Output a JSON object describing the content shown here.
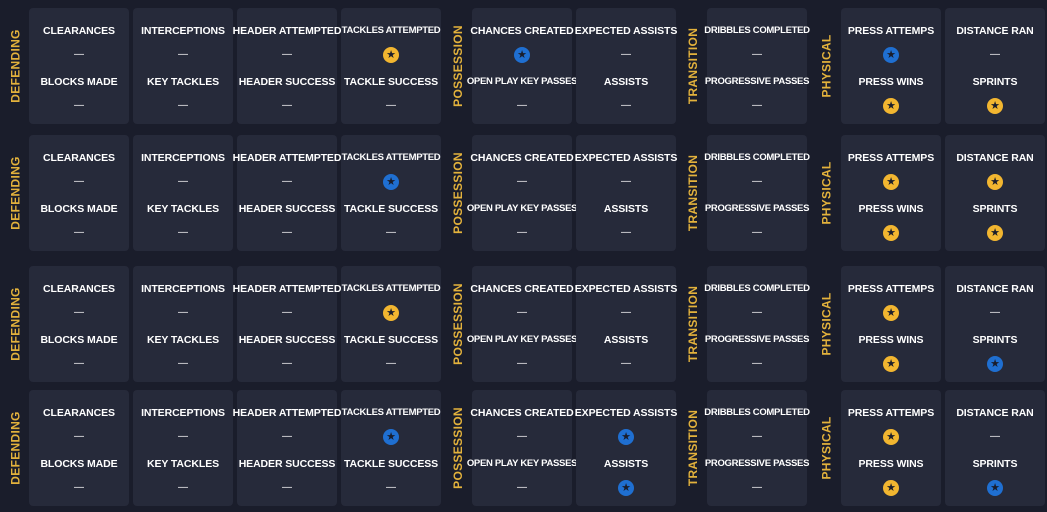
{
  "sections": {
    "defending": "DEFENDING",
    "possession": "POSSESSION",
    "transition": "TRANSITION",
    "physical": "PHYSICAL"
  },
  "colors": {
    "gold_star": "#f2b630",
    "blue_star": "#1f6fd1",
    "section_label": "#e3b23c"
  },
  "icons": {
    "star": "star-icon"
  },
  "dash": "—",
  "rows": [
    {
      "defending": [
        [
          {
            "label": "CLEARANCES",
            "value": "dash"
          },
          {
            "label": "BLOCKS MADE",
            "value": "dash"
          }
        ],
        [
          {
            "label": "INTERCEPTIONS",
            "value": "dash"
          },
          {
            "label": "KEY TACKLES",
            "value": "dash"
          }
        ],
        [
          {
            "label": "HEADER ATTEMPTED",
            "value": "dash"
          },
          {
            "label": "HEADER SUCCESS",
            "value": "dash"
          }
        ],
        [
          {
            "label": "TACKLES ATTEMPTED",
            "value": "gold"
          },
          {
            "label": "TACKLE SUCCESS",
            "value": "dash"
          }
        ]
      ],
      "possession": [
        [
          {
            "label": "CHANCES CREATED",
            "value": "blue"
          },
          {
            "label": "OPEN PLAY KEY PASSES",
            "value": "dash"
          }
        ],
        [
          {
            "label": "EXPECTED ASSISTS",
            "value": "dash"
          },
          {
            "label": "ASSISTS",
            "value": "dash"
          }
        ]
      ],
      "transition": [
        [
          {
            "label": "DRIBBLES COMPLETED",
            "value": "dash"
          },
          {
            "label": "PROGRESSIVE PASSES",
            "value": "dash"
          }
        ]
      ],
      "physical": [
        [
          {
            "label": "PRESS ATTEMPS",
            "value": "blue"
          },
          {
            "label": "PRESS WINS",
            "value": "gold"
          }
        ],
        [
          {
            "label": "DISTANCE RAN",
            "value": "dash"
          },
          {
            "label": "SPRINTS",
            "value": "gold"
          }
        ]
      ]
    },
    {
      "defending": [
        [
          {
            "label": "CLEARANCES",
            "value": "dash"
          },
          {
            "label": "BLOCKS MADE",
            "value": "dash"
          }
        ],
        [
          {
            "label": "INTERCEPTIONS",
            "value": "dash"
          },
          {
            "label": "KEY TACKLES",
            "value": "dash"
          }
        ],
        [
          {
            "label": "HEADER ATTEMPTED",
            "value": "dash"
          },
          {
            "label": "HEADER SUCCESS",
            "value": "dash"
          }
        ],
        [
          {
            "label": "TACKLES ATTEMPTED",
            "value": "blue"
          },
          {
            "label": "TACKLE SUCCESS",
            "value": "dash"
          }
        ]
      ],
      "possession": [
        [
          {
            "label": "CHANCES CREATED",
            "value": "dash"
          },
          {
            "label": "OPEN PLAY KEY PASSES",
            "value": "dash"
          }
        ],
        [
          {
            "label": "EXPECTED ASSISTS",
            "value": "dash"
          },
          {
            "label": "ASSISTS",
            "value": "dash"
          }
        ]
      ],
      "transition": [
        [
          {
            "label": "DRIBBLES COMPLETED",
            "value": "dash"
          },
          {
            "label": "PROGRESSIVE PASSES",
            "value": "dash"
          }
        ]
      ],
      "physical": [
        [
          {
            "label": "PRESS ATTEMPS",
            "value": "gold"
          },
          {
            "label": "PRESS WINS",
            "value": "gold"
          }
        ],
        [
          {
            "label": "DISTANCE RAN",
            "value": "gold"
          },
          {
            "label": "SPRINTS",
            "value": "gold"
          }
        ]
      ]
    },
    {
      "defending": [
        [
          {
            "label": "CLEARANCES",
            "value": "dash"
          },
          {
            "label": "BLOCKS MADE",
            "value": "dash"
          }
        ],
        [
          {
            "label": "INTERCEPTIONS",
            "value": "dash"
          },
          {
            "label": "KEY TACKLES",
            "value": "dash"
          }
        ],
        [
          {
            "label": "HEADER ATTEMPTED",
            "value": "dash"
          },
          {
            "label": "HEADER SUCCESS",
            "value": "dash"
          }
        ],
        [
          {
            "label": "TACKLES ATTEMPTED",
            "value": "gold"
          },
          {
            "label": "TACKLE SUCCESS",
            "value": "dash"
          }
        ]
      ],
      "possession": [
        [
          {
            "label": "CHANCES CREATED",
            "value": "dash"
          },
          {
            "label": "OPEN PLAY KEY PASSES",
            "value": "dash"
          }
        ],
        [
          {
            "label": "EXPECTED ASSISTS",
            "value": "dash"
          },
          {
            "label": "ASSISTS",
            "value": "dash"
          }
        ]
      ],
      "transition": [
        [
          {
            "label": "DRIBBLES COMPLETED",
            "value": "dash"
          },
          {
            "label": "PROGRESSIVE PASSES",
            "value": "dash"
          }
        ]
      ],
      "physical": [
        [
          {
            "label": "PRESS ATTEMPS",
            "value": "gold"
          },
          {
            "label": "PRESS WINS",
            "value": "gold"
          }
        ],
        [
          {
            "label": "DISTANCE RAN",
            "value": "dash"
          },
          {
            "label": "SPRINTS",
            "value": "blue"
          }
        ]
      ]
    },
    {
      "defending": [
        [
          {
            "label": "CLEARANCES",
            "value": "dash"
          },
          {
            "label": "BLOCKS MADE",
            "value": "dash"
          }
        ],
        [
          {
            "label": "INTERCEPTIONS",
            "value": "dash"
          },
          {
            "label": "KEY TACKLES",
            "value": "dash"
          }
        ],
        [
          {
            "label": "HEADER ATTEMPTED",
            "value": "dash"
          },
          {
            "label": "HEADER SUCCESS",
            "value": "dash"
          }
        ],
        [
          {
            "label": "TACKLES ATTEMPTED",
            "value": "blue"
          },
          {
            "label": "TACKLE SUCCESS",
            "value": "dash"
          }
        ]
      ],
      "possession": [
        [
          {
            "label": "CHANCES CREATED",
            "value": "dash"
          },
          {
            "label": "OPEN PLAY KEY PASSES",
            "value": "dash"
          }
        ],
        [
          {
            "label": "EXPECTED ASSISTS",
            "value": "blue"
          },
          {
            "label": "ASSISTS",
            "value": "blue"
          }
        ]
      ],
      "transition": [
        [
          {
            "label": "DRIBBLES COMPLETED",
            "value": "dash"
          },
          {
            "label": "PROGRESSIVE PASSES",
            "value": "dash"
          }
        ]
      ],
      "physical": [
        [
          {
            "label": "PRESS ATTEMPS",
            "value": "gold"
          },
          {
            "label": "PRESS WINS",
            "value": "gold"
          }
        ],
        [
          {
            "label": "DISTANCE RAN",
            "value": "dash"
          },
          {
            "label": "SPRINTS",
            "value": "blue"
          }
        ]
      ]
    }
  ]
}
